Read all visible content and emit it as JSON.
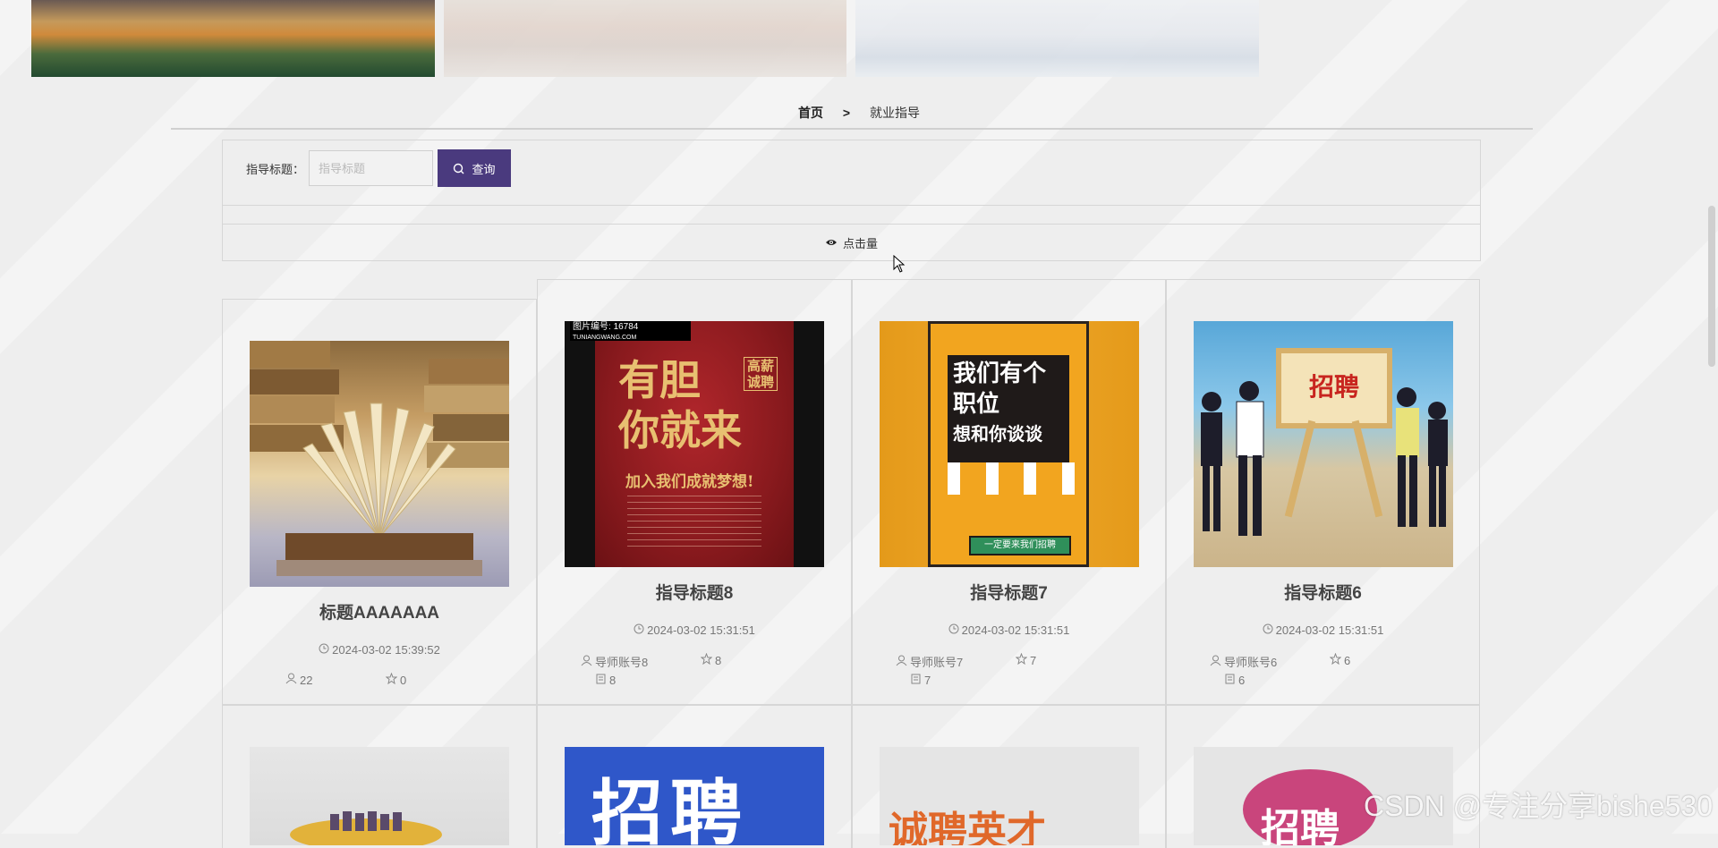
{
  "breadcrumb": {
    "home": "首页",
    "separator": ">",
    "current": "就业指导"
  },
  "search": {
    "label": "指导标题：",
    "placeholder": "指导标题",
    "value": "",
    "button_label": "查询"
  },
  "sort": {
    "label": "点击量"
  },
  "cards": [
    {
      "title": "标题AAAAAAA",
      "date": "2024-03-02 15:39:52",
      "views": "22",
      "favorites": "0"
    },
    {
      "title": "指导标题8",
      "date": "2024-03-02 15:31:51",
      "account": "导师账号8",
      "favorites": "8",
      "comments": "8"
    },
    {
      "title": "指导标题7",
      "date": "2024-03-02 15:31:51",
      "account": "导师账号7",
      "favorites": "7",
      "comments": "7"
    },
    {
      "title": "指导标题6",
      "date": "2024-03-02 15:31:51",
      "account": "导师账号6",
      "favorites": "6",
      "comments": "6"
    }
  ],
  "posters": {
    "p8": {
      "code_label": "图片编号:",
      "code_value": "16784",
      "site": "TUNIANGWANG.COM",
      "line1": "有胆",
      "line2": "你就来",
      "badge": "高薪诚聘",
      "slogan": "加入我们成就梦想!"
    },
    "p7": {
      "line1": "我们有个",
      "line2": "职位",
      "line3": "想和你谈谈",
      "button": "一定要来我们招聘"
    },
    "p6": {
      "board": "招聘"
    },
    "bottom": [
      "招聘",
      "诚聘英才",
      "招聘"
    ]
  },
  "watermark": "CSDN @专注分享bishe530",
  "colors": {
    "primary": "#4a3a7e",
    "border": "#d6d6d6",
    "background": "#eeeeee"
  },
  "icons": [
    "search-icon",
    "eye-icon",
    "clock-icon",
    "user-icon",
    "star-icon",
    "comment-icon"
  ]
}
